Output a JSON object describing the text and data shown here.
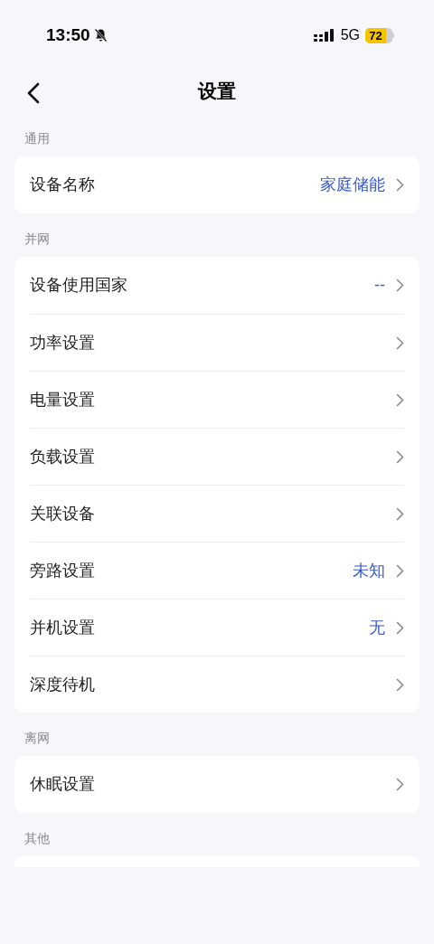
{
  "status_bar": {
    "time": "13:50",
    "network": "5G",
    "battery": "72"
  },
  "header": {
    "title": "设置"
  },
  "sections": [
    {
      "title": "通用",
      "items": [
        {
          "label": "设备名称",
          "value": "家庭储能"
        }
      ]
    },
    {
      "title": "并网",
      "items": [
        {
          "label": "设备使用国家",
          "value": "--"
        },
        {
          "label": "功率设置"
        },
        {
          "label": "电量设置"
        },
        {
          "label": "负载设置"
        },
        {
          "label": "关联设备"
        },
        {
          "label": "旁路设置",
          "value": "未知"
        },
        {
          "label": "并机设置",
          "value": "无"
        },
        {
          "label": "深度待机"
        }
      ]
    },
    {
      "title": "离网",
      "items": [
        {
          "label": "休眠设置"
        }
      ]
    },
    {
      "title": "其他"
    }
  ]
}
